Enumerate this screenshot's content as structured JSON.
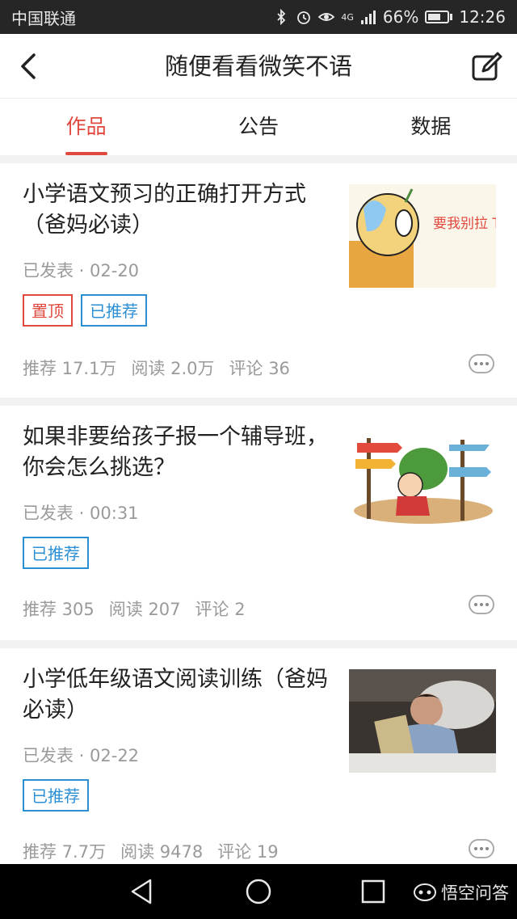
{
  "status_bar": {
    "carrier": "中国联通",
    "network": "4G",
    "battery": "66%",
    "battery_level": 0.66,
    "time": "12:26",
    "icons": [
      "bluetooth-icon",
      "alarm-icon",
      "eye-icon",
      "signal-icon",
      "battery-icon"
    ]
  },
  "nav": {
    "title": "随便看看微笑不语",
    "back_icon": "chevron-left-icon",
    "edit_icon": "edit-icon"
  },
  "tabs": [
    {
      "label": "作品",
      "active": true
    },
    {
      "label": "公告",
      "active": false
    },
    {
      "label": "数据",
      "active": false
    }
  ],
  "articles": [
    {
      "title": "小学语文预习的正确打开方式（爸妈必读）",
      "meta": "已发表 · 02-20",
      "tags": [
        {
          "label": "置顶",
          "type": "pinned"
        },
        {
          "label": "已推荐",
          "type": "recommended"
        }
      ],
      "stats": {
        "recommend": "推荐 17.1万",
        "read": "阅读 2.0万",
        "comment": "评论 36"
      },
      "thumb_text": "要我别拉 TAT !!"
    },
    {
      "title": "如果非要给孩子报一个辅导班，你会怎么挑选？",
      "meta": "已发表 · 00:31",
      "tags": [
        {
          "label": "已推荐",
          "type": "recommended"
        }
      ],
      "stats": {
        "recommend": "推荐 305",
        "read": "阅读 207",
        "comment": "评论 2"
      }
    },
    {
      "title": "小学低年级语文阅读训练（爸妈必读）",
      "meta": "已发表 · 02-22",
      "tags": [
        {
          "label": "已推荐",
          "type": "recommended"
        }
      ],
      "stats": {
        "recommend": "推荐 7.7万",
        "read": "阅读 9478",
        "comment": "评论 19"
      }
    }
  ],
  "bottom_nav": {
    "icons": [
      "back-triangle-icon",
      "home-circle-icon",
      "recents-square-icon"
    ],
    "watermark": "悟空问答"
  },
  "colors": {
    "accent": "#e1493f",
    "recommended": "#2b8fd6",
    "muted": "#9a9a9a",
    "status_bar": "#262626"
  }
}
